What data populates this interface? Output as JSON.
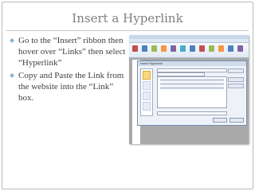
{
  "slide": {
    "title": "Insert a Hyperlink",
    "bullets": [
      "Go to the “Insert” ribbon then hover over “Links” then select “Hyperlink”",
      "Copy and Paste the Link from the website into the “Link” box."
    ],
    "bullet_glyph": "◆"
  },
  "screenshot": {
    "dialog_title": "Insert Hyperlink",
    "ribbon_icon_colors": [
      "#c0504d",
      "#4f81bd",
      "#9bbb59",
      "#f79646",
      "#8064a2",
      "#4bacc6",
      "#4f81bd",
      "#c0504d",
      "#9bbb59",
      "#f79646",
      "#4f81bd",
      "#8064a2"
    ]
  },
  "colors": {
    "title": "#7f7f7f",
    "bullet_text": "#404040",
    "bullet_mark": "#8cb5d4"
  }
}
